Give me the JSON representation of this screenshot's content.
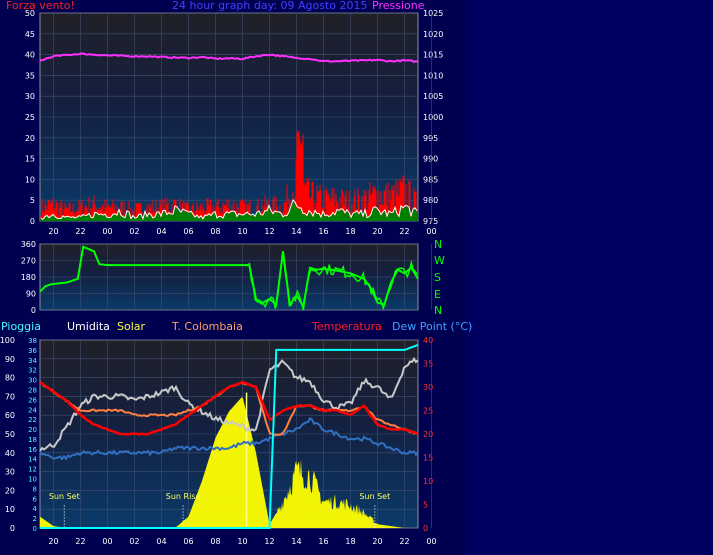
{
  "colors": {
    "wind": "#ff2020",
    "gust_fill": "#ff0000",
    "avg_fill": "#008000",
    "avg_line": "#ffffff",
    "pressure": "#ff30ff",
    "direction": "#00ff00",
    "rain": "#ffff60",
    "humidity": "#c8c8c8",
    "solar": "#ffff00",
    "temperature": "#ff0000",
    "apparent": "#ff8040",
    "dew_point": "#3070c0",
    "rain_cumulative": "#00ffff",
    "title": "#4040ff",
    "axis_text": "#ffffff"
  },
  "header": {
    "left_label": "Forza vento!",
    "title": "24 hour graph day: 09 Agosto 2015",
    "right_label": "Pressione"
  },
  "legend2": {
    "pioggia": "Pioggia",
    "umidita": "Umidita",
    "solar": "Solar",
    "apparent": "T. Colombaia",
    "temperature": "Temperatura",
    "dewpoint": "Dew Point (°C)"
  },
  "compass": [
    "N",
    "W",
    "S",
    "E",
    "N"
  ],
  "sun_labels": [
    "Sun Set",
    "Sun Rise",
    "Sun Set"
  ],
  "chart_data": [
    {
      "type": "line",
      "title": "24 hour graph day: 09 Agosto 2015",
      "x_ticks": [
        "20",
        "22",
        "00",
        "02",
        "04",
        "06",
        "08",
        "10",
        "12",
        "14",
        "16",
        "18",
        "20",
        "22",
        "00"
      ],
      "y_left": {
        "label": "Forza vento!",
        "ticks": [
          0,
          5,
          10,
          15,
          20,
          25,
          30,
          35,
          40,
          45,
          50
        ],
        "lim": [
          0,
          50
        ]
      },
      "y_right": {
        "label": "Pressione",
        "ticks": [
          975,
          980,
          985,
          990,
          995,
          1000,
          1005,
          1010,
          1015,
          1020,
          1025
        ],
        "lim": [
          975,
          1025
        ]
      },
      "grid": true,
      "series": [
        {
          "name": "Pressione",
          "axis": "right",
          "x": [
            0,
            1,
            2,
            3,
            4,
            5,
            6,
            7,
            8,
            9,
            10,
            11,
            12,
            13,
            14,
            15,
            16,
            17,
            18,
            19,
            20,
            21,
            22,
            23,
            24,
            25,
            26,
            27,
            28
          ],
          "values": [
            1013.5,
            1014.6,
            1014.9,
            1015.2,
            1015.0,
            1014.8,
            1014.7,
            1014.6,
            1014.6,
            1014.4,
            1014.3,
            1014.2,
            1014.4,
            1014.0,
            1014.1,
            1014.0,
            1014.6,
            1015.0,
            1014.6,
            1014.2,
            1014.0,
            1013.4,
            1013.4,
            1013.5,
            1013.6,
            1013.7,
            1013.4,
            1013.6,
            1013.3
          ]
        },
        {
          "name": "Gust",
          "axis": "left",
          "x": [
            0,
            1,
            2,
            3,
            4,
            5,
            6,
            7,
            8,
            9,
            10,
            11,
            12,
            13,
            14,
            15,
            16,
            17,
            18,
            19,
            20,
            21,
            22,
            23,
            24,
            25,
            26,
            27,
            28
          ],
          "values": [
            5,
            6,
            4,
            5,
            6,
            5,
            5,
            4,
            5,
            5,
            6,
            4,
            5,
            5,
            6,
            5,
            5,
            6,
            5,
            15,
            9,
            8,
            8,
            7,
            8,
            10,
            9,
            11,
            6
          ]
        },
        {
          "name": "Average",
          "axis": "left",
          "x": [
            0,
            1,
            2,
            3,
            4,
            5,
            6,
            7,
            8,
            9,
            10,
            11,
            12,
            13,
            14,
            15,
            16,
            17,
            18,
            19,
            20,
            21,
            22,
            23,
            24,
            25,
            26,
            27,
            28
          ],
          "values": [
            1,
            2,
            1,
            1,
            2,
            2,
            3,
            1,
            2,
            2,
            3,
            2,
            1,
            2,
            2,
            2,
            2,
            3,
            2,
            5,
            3,
            2,
            3,
            2,
            2,
            3,
            2,
            4,
            2
          ]
        }
      ]
    },
    {
      "type": "line",
      "x_ticks": [
        "20",
        "22",
        "00",
        "02",
        "04",
        "06",
        "08",
        "10",
        "12",
        "14",
        "16",
        "18",
        "20",
        "22",
        "00"
      ],
      "y": {
        "ticks": [
          0,
          90,
          180,
          270,
          360
        ],
        "lim": [
          0,
          360
        ]
      },
      "compass": [
        "N",
        "W",
        "S",
        "E",
        "N"
      ],
      "series": [
        {
          "name": "Direction",
          "x": [
            0,
            0.4,
            0.8,
            1.4,
            2.0,
            2.8,
            3.2,
            4.0,
            4.4,
            5.0,
            6.0,
            8.0,
            10.0,
            12.0,
            14.0,
            15.5,
            16.0,
            16.5,
            17.0,
            17.5,
            18.0,
            18.5,
            19.0,
            19.5,
            20.0,
            20.5,
            21.0,
            22.0,
            23.0,
            24.0,
            24.5,
            25.0,
            25.5,
            26.0,
            26.5,
            27.0,
            27.5,
            28.0
          ],
          "values": [
            100,
            130,
            140,
            145,
            150,
            170,
            345,
            320,
            250,
            245,
            245,
            245,
            245,
            245,
            245,
            245,
            60,
            40,
            60,
            30,
            320,
            30,
            80,
            20,
            230,
            220,
            225,
            215,
            200,
            170,
            120,
            40,
            30,
            150,
            220,
            200,
            230,
            170
          ]
        }
      ]
    },
    {
      "type": "line",
      "x_ticks": [
        "20",
        "22",
        "00",
        "02",
        "04",
        "06",
        "08",
        "10",
        "12",
        "14",
        "16",
        "18",
        "20",
        "22",
        "00"
      ],
      "y_left": {
        "label": "Umidita",
        "ticks": [
          0,
          10,
          20,
          30,
          40,
          50,
          60,
          70,
          80,
          90,
          100
        ],
        "lim": [
          0,
          100
        ]
      },
      "y_rain": {
        "label": "Pioggia",
        "ticks": [
          0,
          2,
          4,
          6,
          8,
          10,
          12,
          14,
          16,
          18,
          20,
          22,
          24,
          26,
          28,
          30,
          32,
          34,
          36,
          38
        ],
        "lim": [
          0,
          38
        ]
      },
      "y_right": {
        "label": "Temperatura",
        "ticks": [
          0,
          5,
          10,
          15,
          20,
          25,
          30,
          35,
          40
        ],
        "lim": [
          0,
          40
        ]
      },
      "annotations": [
        {
          "text": "Sun Set",
          "x": 1.8
        },
        {
          "text": "Sun Rise",
          "x": 10.6
        },
        {
          "text": "Sun Set",
          "x": 24.8
        }
      ],
      "series": [
        {
          "name": "Umidita",
          "axis": "left",
          "x": [
            0,
            1,
            2,
            3,
            4,
            5,
            6,
            7,
            8,
            9,
            10,
            11,
            12,
            13,
            14,
            15,
            16,
            17,
            18,
            19,
            20,
            21,
            22,
            23,
            24,
            25,
            26,
            27,
            28
          ],
          "values": [
            42,
            44,
            54,
            65,
            70,
            70,
            70,
            68,
            70,
            72,
            75,
            66,
            62,
            58,
            56,
            54,
            52,
            84,
            88,
            80,
            78,
            68,
            64,
            66,
            78,
            75,
            68,
            86,
            90
          ]
        },
        {
          "name": "Solar",
          "axis": "left",
          "x": [
            0,
            1,
            2,
            3,
            4,
            5,
            6,
            7,
            8,
            9,
            10,
            11,
            12,
            13,
            14,
            15,
            16,
            17,
            18,
            19,
            20,
            21,
            22,
            23,
            24,
            25,
            26,
            27,
            28
          ],
          "values": [
            6,
            1,
            0,
            0,
            0,
            0,
            0,
            0,
            0,
            0,
            0,
            6,
            25,
            48,
            62,
            70,
            40,
            2,
            14,
            30,
            28,
            14,
            14,
            12,
            8,
            2,
            1,
            0,
            0
          ]
        },
        {
          "name": "T. Colombaia",
          "axis": "right",
          "x": [
            0,
            1,
            2,
            3,
            4,
            5,
            6,
            7,
            8,
            9,
            10,
            11,
            12,
            13,
            14,
            15,
            16,
            17,
            18,
            19,
            20,
            21,
            22,
            23,
            24,
            25,
            26,
            27,
            28
          ],
          "values": [
            31,
            29,
            27,
            25,
            25,
            25,
            25,
            24,
            24,
            24,
            24,
            25,
            26,
            28,
            30,
            31,
            30,
            20,
            20,
            26,
            26,
            25,
            25,
            25,
            26,
            23,
            22,
            21,
            20
          ]
        },
        {
          "name": "Temperatura",
          "axis": "right",
          "x": [
            0,
            1,
            2,
            3,
            4,
            5,
            6,
            7,
            8,
            9,
            10,
            11,
            12,
            13,
            14,
            15,
            16,
            17,
            18,
            19,
            20,
            21,
            22,
            23,
            24,
            25,
            26,
            27,
            28
          ],
          "values": [
            31,
            29,
            27,
            24,
            22,
            21,
            20,
            20,
            20,
            21,
            22,
            24,
            26,
            28,
            30,
            31,
            30,
            23,
            25,
            26,
            26,
            25,
            25,
            24,
            26,
            22,
            21,
            21,
            20
          ]
        },
        {
          "name": "Dew Point",
          "axis": "right",
          "x": [
            0,
            1,
            2,
            3,
            4,
            5,
            6,
            7,
            8,
            9,
            10,
            11,
            12,
            13,
            14,
            15,
            16,
            17,
            18,
            19,
            20,
            21,
            22,
            23,
            24,
            25,
            26,
            27,
            28
          ],
          "values": [
            16,
            15,
            15,
            16,
            16,
            16,
            16,
            16,
            16,
            16,
            17,
            17,
            17,
            17,
            17,
            18,
            18,
            19,
            20,
            21,
            23,
            21,
            20,
            19,
            19,
            18,
            17,
            16,
            16
          ]
        },
        {
          "name": "Pioggia",
          "axis": "rain",
          "x": [
            0,
            1,
            2,
            3,
            4,
            5,
            6,
            7,
            8,
            9,
            10,
            11,
            12,
            13,
            14,
            15,
            16,
            17,
            17.5,
            18,
            19,
            20,
            21,
            22,
            23,
            24,
            25,
            26,
            27,
            28
          ],
          "values": [
            0,
            0,
            0,
            0,
            0,
            0,
            0,
            0,
            0,
            0,
            0,
            0,
            0,
            0,
            0,
            0,
            0,
            0,
            36,
            36,
            36,
            36,
            36,
            36,
            36,
            36,
            36,
            36,
            36,
            37
          ]
        }
      ]
    }
  ]
}
